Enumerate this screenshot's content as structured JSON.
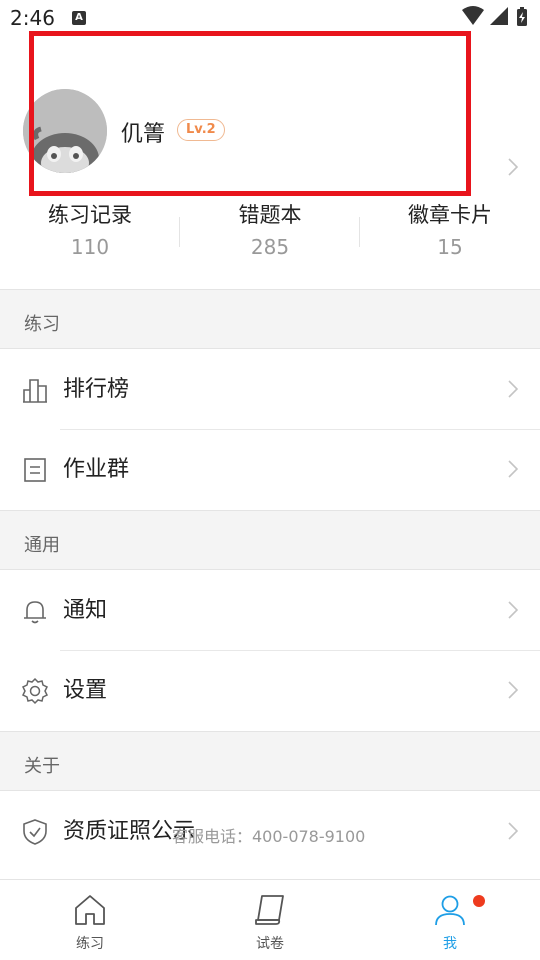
{
  "status_bar": {
    "time": "2:46",
    "notification_glyph": "A"
  },
  "profile": {
    "username": "仉箐",
    "level": "Lv.2"
  },
  "stats": [
    {
      "label": "练习记录",
      "value": "110"
    },
    {
      "label": "错题本",
      "value": "285"
    },
    {
      "label": "徽章卡片",
      "value": "15"
    }
  ],
  "sections": {
    "practice": {
      "title": "练习",
      "items": [
        {
          "label": "排行榜",
          "icon": "ranking-chart-icon"
        },
        {
          "label": "作业群",
          "icon": "document-list-icon"
        }
      ]
    },
    "general": {
      "title": "通用",
      "items": [
        {
          "label": "通知",
          "icon": "bell-icon"
        },
        {
          "label": "设置",
          "icon": "gear-icon"
        }
      ]
    },
    "about": {
      "title": "关于",
      "items": [
        {
          "label": "资质证照公示",
          "icon": "shield-check-icon"
        }
      ]
    }
  },
  "hotline": "客服电话：400-078-9100",
  "bottom_nav": [
    {
      "label": "练习",
      "icon": "home-icon",
      "active": false
    },
    {
      "label": "试卷",
      "icon": "paper-scroll-icon",
      "active": false
    },
    {
      "label": "我",
      "icon": "user-icon",
      "active": true,
      "has_badge": true
    }
  ],
  "colors": {
    "accent": "#1E9EE6",
    "highlight_box": "#E8141C",
    "level_badge": "#F08A4B",
    "notification_dot": "#EE3B1E"
  }
}
